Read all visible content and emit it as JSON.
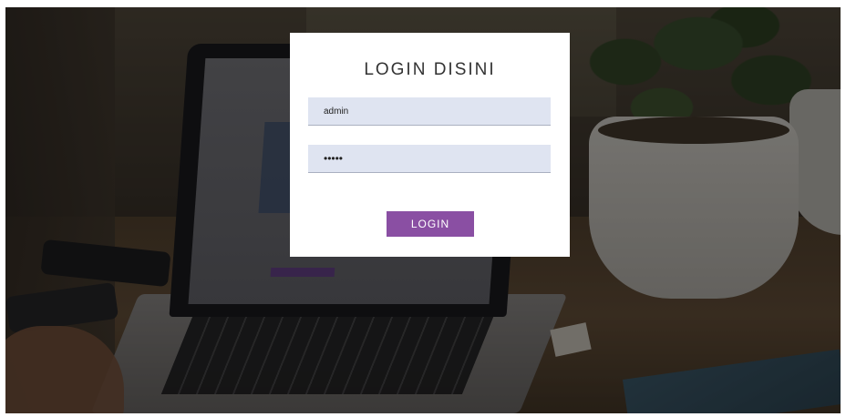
{
  "login": {
    "title": "LOGIN DISINI",
    "username_value": "admin",
    "password_value": "•••••",
    "button_label": "LOGIN"
  },
  "colors": {
    "button_bg": "#8a4fa3",
    "field_bg": "#dfe4f1",
    "card_bg": "#ffffff"
  }
}
